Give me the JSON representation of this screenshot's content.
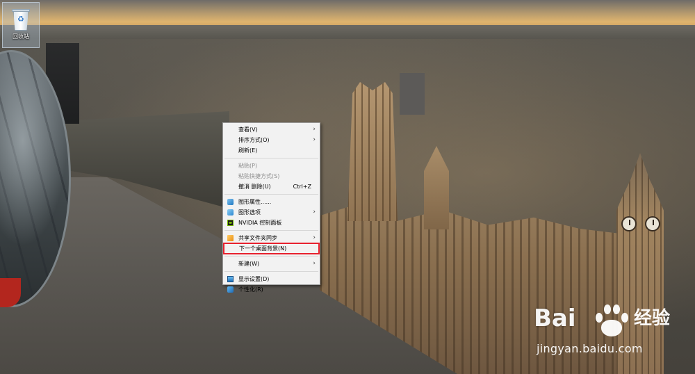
{
  "desktop": {
    "recycle_bin_label": "回收站"
  },
  "context_menu": {
    "items": [
      {
        "label": "查看(V)",
        "submenu": true
      },
      {
        "label": "排序方式(O)",
        "submenu": true
      },
      {
        "label": "刷新(E)"
      },
      {
        "label": "粘贴(P)",
        "disabled": true
      },
      {
        "label": "粘贴快捷方式(S)",
        "disabled": true
      },
      {
        "label": "撤消 删除(U)",
        "shortcut": "Ctrl+Z"
      },
      {
        "label": "图形属性......",
        "icon": "intel-graphics-icon"
      },
      {
        "label": "图形选项",
        "icon": "intel-graphics-options-icon",
        "submenu": true
      },
      {
        "label": "NVIDIA 控制面板",
        "icon": "nvidia-icon"
      },
      {
        "label": "共享文件夹同步",
        "icon": "shared-folder-icon",
        "submenu": true
      },
      {
        "label": "下一个桌面背景(N)",
        "highlighted": true
      },
      {
        "label": "新建(W)",
        "submenu": true
      },
      {
        "label": "显示设置(D)",
        "icon": "display-settings-icon"
      },
      {
        "label": "个性化(R)",
        "icon": "personalize-icon"
      }
    ],
    "submenu_arrow": "›",
    "highlight_color": "#e8212e"
  },
  "watermark": {
    "logo_left": "Bai",
    "logo_right": "经验",
    "url": "jingyan.baidu.com"
  }
}
